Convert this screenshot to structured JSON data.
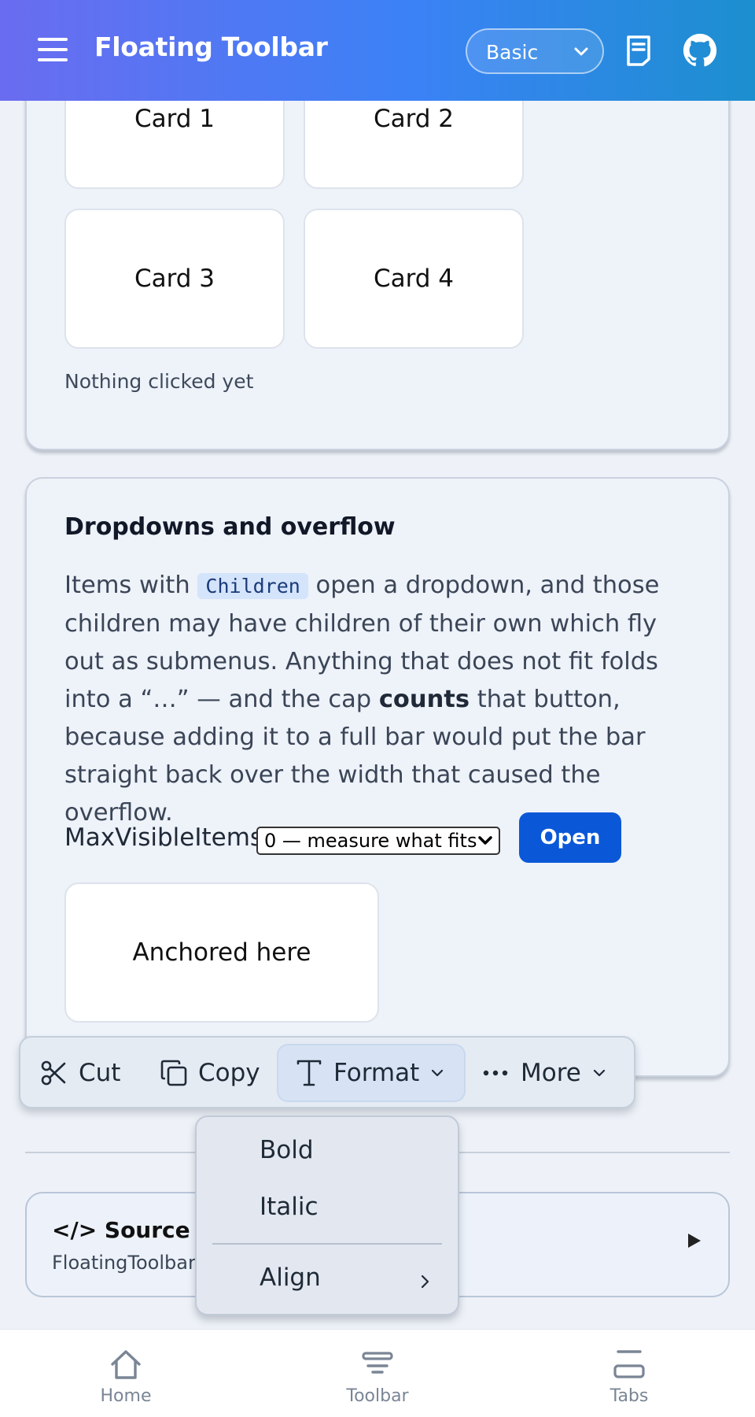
{
  "header": {
    "title": "Floating Toolbar",
    "theme_value": "Basic"
  },
  "cards": {
    "card1": "Card 1",
    "card2": "Card 2",
    "card3": "Card 3",
    "card4": "Card 4",
    "status": "Nothing clicked yet"
  },
  "section": {
    "title": "Dropdowns and overflow",
    "desc_part1": "Items with ",
    "desc_code": "Children",
    "desc_part2": " open a dropdown, and those children may have children of their own which fly out as submenus. Anything that does not fit folds into a “…” — and the cap ",
    "desc_bold": "counts",
    "desc_part3": " that button, because adding it to a full bar would put the bar straight back over the width that caused the overflow.",
    "max_visible_label": "MaxVisibleItems",
    "max_visible_value": "0 — measure what fits",
    "open_button": "Open",
    "anchor_label": "Anchored here"
  },
  "toolbar": {
    "cut": "Cut",
    "copy": "Copy",
    "format": "Format",
    "more": "More"
  },
  "format_menu": {
    "bold": "Bold",
    "italic": "Italic",
    "align": "Align"
  },
  "source": {
    "title": "</> Source Co",
    "subtitle": "FloatingToolbarF"
  },
  "bottom_nav": {
    "home": "Home",
    "toolbar": "Toolbar",
    "tabs": "Tabs"
  },
  "colors": {
    "header_gradient_start": "#6a6cf0",
    "header_gradient_end": "#1c8fcf",
    "primary_button": "#0a58d8",
    "page_background": "#eef2f8"
  },
  "icons": [
    "menu-icon",
    "chevron-down-icon",
    "docs-icon",
    "github-icon",
    "scissors-icon",
    "copy-icon",
    "text-format-icon",
    "ellipsis-icon",
    "chevron-right-icon",
    "play-triangle-icon",
    "home-icon",
    "toolbar-icon",
    "tabs-icon"
  ]
}
